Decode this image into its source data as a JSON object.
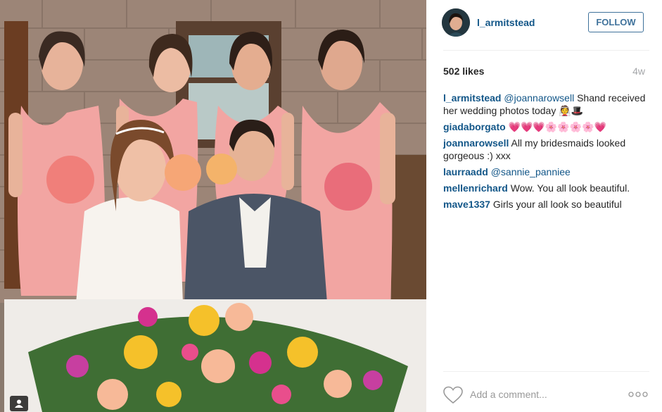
{
  "post": {
    "username": "l_armitstead",
    "follow_label": "FOLLOW",
    "likes": "502 likes",
    "time_ago": "4w"
  },
  "comments": [
    {
      "user": "l_armitstead",
      "mention": "@joannarowsell",
      "text": " Shand received her wedding photos today 👰🎩"
    },
    {
      "user": "giadaborgato",
      "mention": "",
      "text": "💗💗💗🌸🌸🌸🌸💗"
    },
    {
      "user": "joannarowsell",
      "mention": "",
      "text": "All my bridesmaids looked gorgeous :) xxx"
    },
    {
      "user": "laurraadd",
      "mention": "@sannie_panniee",
      "text": ""
    },
    {
      "user": "mellenrichard",
      "mention": "",
      "text": "Wow. You all look beautiful."
    },
    {
      "user": "mave1337",
      "mention": "",
      "text": "Girls your all look so beautiful"
    }
  ],
  "footer": {
    "comment_placeholder": "Add a comment..."
  },
  "icons": {
    "heart": "heart-icon",
    "more": "more-options-icon",
    "tag": "user-tag-icon"
  },
  "colors": {
    "link": "#125688",
    "follow_border": "#3f729b",
    "muted": "#a5a7aa"
  }
}
